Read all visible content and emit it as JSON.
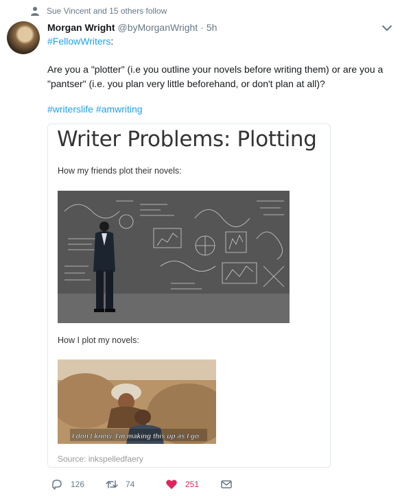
{
  "social_context": {
    "text": "Sue Vincent and 15 others follow",
    "icon": "person-icon"
  },
  "author": {
    "name": "Morgan Wright",
    "handle": "@byMorganWright",
    "separator": "·",
    "time": "5h"
  },
  "tweet": {
    "first_line_hashtag": "#FellowWriters",
    "first_line_punct": ":",
    "body": "Are you a \"plotter\" (i.e you outline your novels before writing them) or are you a \"pantser\" (i.e. you plan very little beforehand, or don't plan at all)?",
    "hashtags": [
      "#writerslife",
      "#amwriting"
    ]
  },
  "media": {
    "title": "Writer Problems: Plotting",
    "caption_friends": "How my friends plot their novels:",
    "caption_me": "How I plot my novels:",
    "subtitle": "I don't know, I'm making this up as I go.",
    "source": "Source: inkspelledfaery"
  },
  "actions": {
    "replies": "126",
    "retweets": "74",
    "likes": "251",
    "like_color": "#e0245e",
    "icons": [
      "reply-icon",
      "retweet-icon",
      "heart-icon",
      "direct-message-icon"
    ]
  },
  "colors": {
    "link": "#1da1f2",
    "muted": "#657786",
    "text": "#14171a"
  }
}
